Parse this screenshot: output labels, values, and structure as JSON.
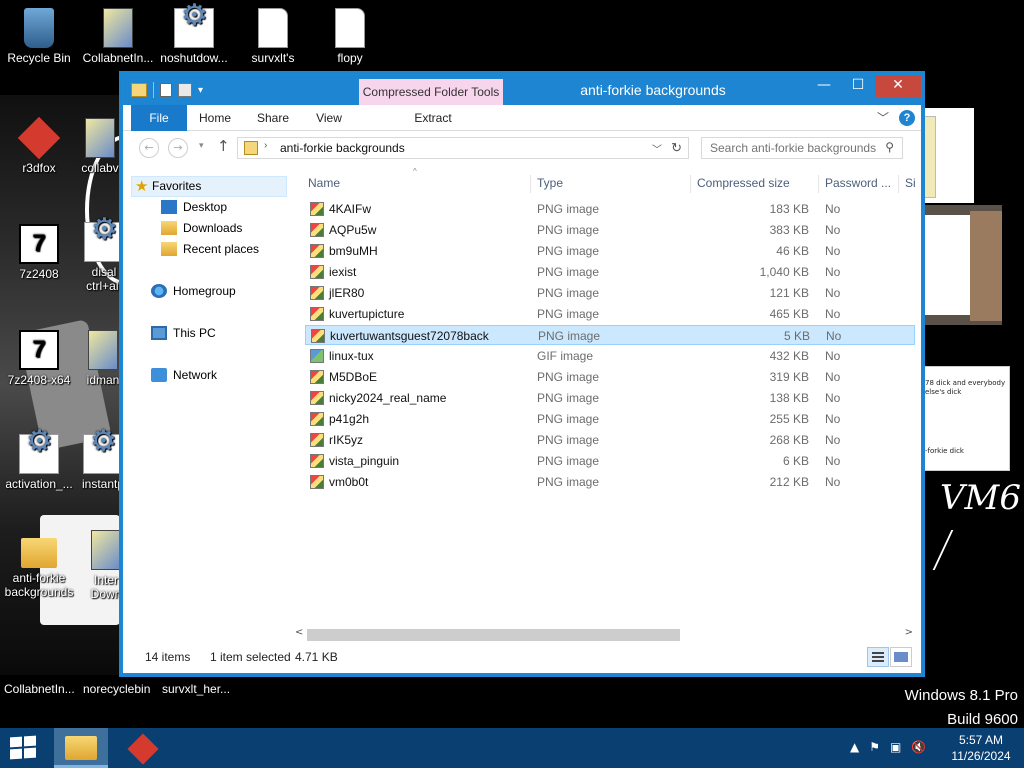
{
  "desktop": {
    "top_icons": [
      {
        "label": "Recycle Bin"
      },
      {
        "label": "CollabnetIn..."
      },
      {
        "label": "noshutdow..."
      },
      {
        "label": "survxlt's"
      },
      {
        "label": "flopy"
      }
    ],
    "left_icons": [
      {
        "label": "r3dfox"
      },
      {
        "label": "collabv"
      },
      {
        "label": "7z2408"
      },
      {
        "label": "disal ctrl+alt"
      },
      {
        "label": "7z2408-x64"
      },
      {
        "label": "idman"
      },
      {
        "label": "activation_..."
      },
      {
        "label": "instantp"
      },
      {
        "label": "anti-forkie backgrounds"
      },
      {
        "label": "Inter Down"
      }
    ],
    "bottom_labels": [
      {
        "label": "CollabnetIn..."
      },
      {
        "label": "norecyclebin"
      },
      {
        "label": "survxlt_her..."
      }
    ],
    "background_text": {
      "note_line": "78 dick and everybody else's dick",
      "note_line2": "-forkie dick",
      "vm_text": "VM6"
    },
    "windows_version": "Windows 8.1 Pro",
    "build": "Build 9600"
  },
  "window": {
    "title": "anti-forkie backgrounds",
    "context_tab": "Compressed Folder Tools",
    "ribbon_tabs": {
      "file": "File",
      "home": "Home",
      "share": "Share",
      "view": "View",
      "extract": "Extract"
    },
    "close_glyph": "✕",
    "minimize_glyph": "—",
    "maximize_glyph": "☐",
    "address": {
      "path": "anti-forkie backgrounds"
    },
    "search": {
      "placeholder": "Search anti-forkie backgrounds"
    },
    "nav_pane": {
      "favorites": "Favorites",
      "desktop": "Desktop",
      "downloads": "Downloads",
      "recent": "Recent places",
      "homegroup": "Homegroup",
      "this_pc": "This PC",
      "network": "Network"
    },
    "columns": {
      "name": "Name",
      "type": "Type",
      "compressed_size": "Compressed size",
      "password": "Password ...",
      "size": "Si"
    },
    "files": [
      {
        "name": "4KAIFw",
        "type": "PNG image",
        "size": "183 KB",
        "password": "No"
      },
      {
        "name": "AQPu5w",
        "type": "PNG image",
        "size": "383 KB",
        "password": "No"
      },
      {
        "name": "bm9uMH",
        "type": "PNG image",
        "size": "46 KB",
        "password": "No"
      },
      {
        "name": "iexist",
        "type": "PNG image",
        "size": "1,040 KB",
        "password": "No"
      },
      {
        "name": "jlER80",
        "type": "PNG image",
        "size": "121 KB",
        "password": "No"
      },
      {
        "name": "kuvertupicture",
        "type": "PNG image",
        "size": "465 KB",
        "password": "No"
      },
      {
        "name": "kuvertuwantsguest72078back",
        "type": "PNG image",
        "size": "5 KB",
        "password": "No"
      },
      {
        "name": "linux-tux",
        "type": "GIF image",
        "size": "432 KB",
        "password": "No"
      },
      {
        "name": "M5DBoE",
        "type": "PNG image",
        "size": "319 KB",
        "password": "No"
      },
      {
        "name": "nicky2024_real_name",
        "type": "PNG image",
        "size": "138 KB",
        "password": "No"
      },
      {
        "name": "p41g2h",
        "type": "PNG image",
        "size": "255 KB",
        "password": "No"
      },
      {
        "name": "rIK5yz",
        "type": "PNG image",
        "size": "268 KB",
        "password": "No"
      },
      {
        "name": "vista_pinguin",
        "type": "PNG image",
        "size": "6 KB",
        "password": "No"
      },
      {
        "name": "vm0b0t",
        "type": "PNG image",
        "size": "212 KB",
        "password": "No"
      }
    ],
    "status": {
      "count": "14 items",
      "selected": "1 item selected",
      "selected_size": "4.71 KB"
    }
  },
  "taskbar": {
    "time": "5:57 AM",
    "date": "11/26/2024"
  },
  "colors": {
    "accent": "#1d85d1",
    "selection": "#cce8ff",
    "taskbar": "#0a3f72",
    "close": "#c7483c"
  }
}
